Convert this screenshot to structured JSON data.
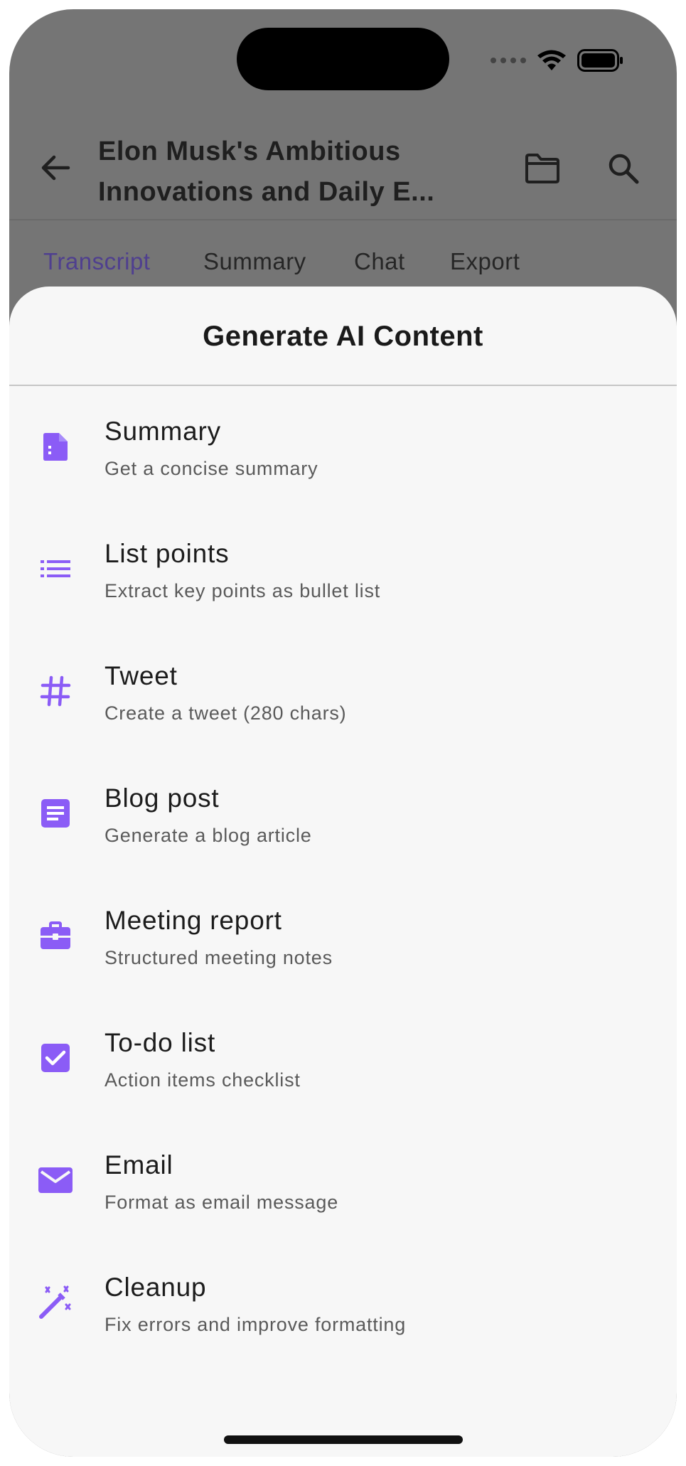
{
  "app_bar": {
    "title_line1": "Elon Musk's Ambitious",
    "title_line2": "Innovations and Daily E...",
    "back_icon": "arrow-back-icon",
    "folder_icon": "folder-icon",
    "search_icon": "search-icon"
  },
  "tabs": [
    {
      "label": "Transcript",
      "active": true
    },
    {
      "label": "Summary",
      "active": false
    },
    {
      "label": "Chat",
      "active": false
    },
    {
      "label": "Export",
      "active": false
    }
  ],
  "sheet": {
    "title": "Generate AI Content",
    "options": [
      {
        "title": "Summary",
        "subtitle": "Get a concise summary",
        "icon": "document-icon"
      },
      {
        "title": "List points",
        "subtitle": "Extract key points as bullet list",
        "icon": "bullet-list-icon"
      },
      {
        "title": "Tweet",
        "subtitle": "Create a tweet (280 chars)",
        "icon": "hashtag-icon"
      },
      {
        "title": "Blog post",
        "subtitle": "Generate a blog article",
        "icon": "article-icon"
      },
      {
        "title": "Meeting report",
        "subtitle": "Structured meeting notes",
        "icon": "briefcase-icon"
      },
      {
        "title": "To-do list",
        "subtitle": "Action items checklist",
        "icon": "checkbox-icon"
      },
      {
        "title": "Email",
        "subtitle": "Format as email message",
        "icon": "mail-icon"
      },
      {
        "title": "Cleanup",
        "subtitle": "Fix errors and improve formatting",
        "icon": "magic-wand-icon"
      }
    ]
  },
  "colors": {
    "accent": "#8b5cf6",
    "scrim": "#757575",
    "sheet_background": "#f7f7f7",
    "active_tab": "#4f3f8f"
  }
}
